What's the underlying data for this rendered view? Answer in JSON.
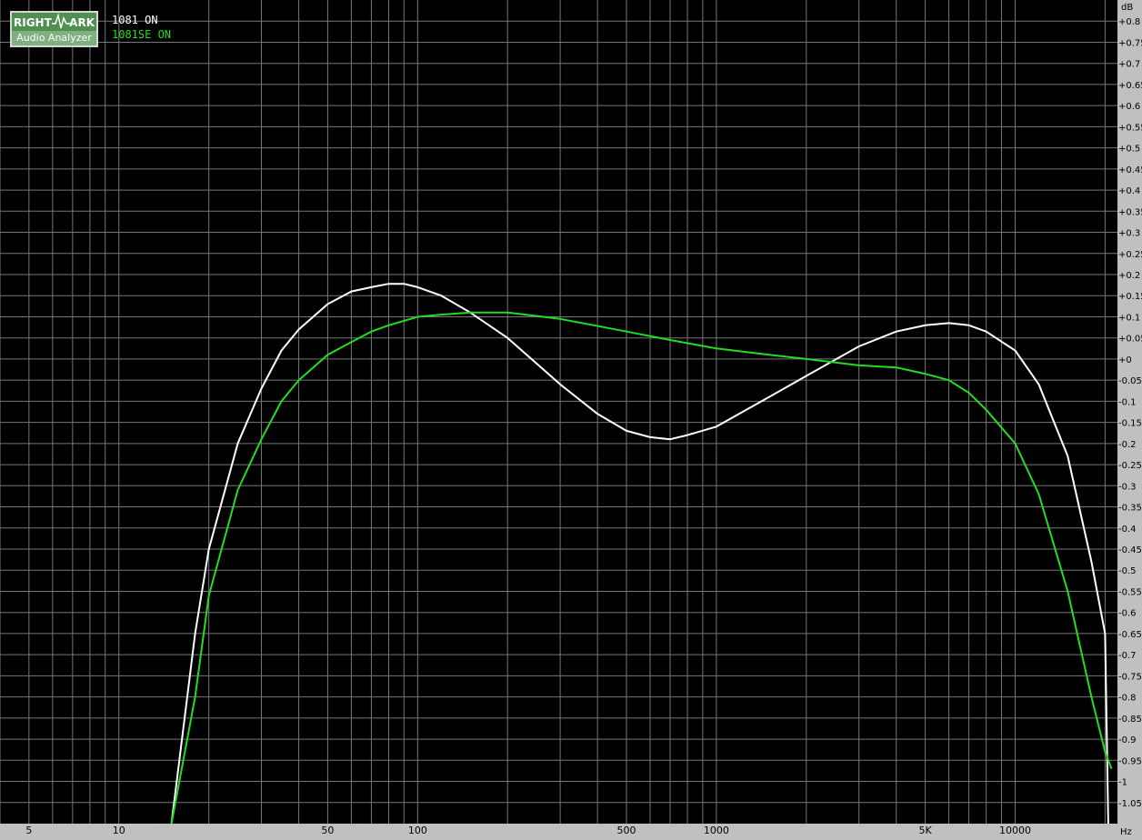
{
  "logo": {
    "word1": "RIGHT",
    "word2": "ARK",
    "subtitle": "Audio Analyzer"
  },
  "legend": [
    {
      "name": "1081 ON",
      "color": "#ffffff"
    },
    {
      "name": "1081SE ON",
      "color": "#22dd22"
    }
  ],
  "chart_data": {
    "type": "line",
    "xscale": "log",
    "xlim": [
      4,
      22000
    ],
    "ylim": [
      -1.1,
      0.85
    ],
    "grid": true,
    "xunit": "Hz",
    "yunit": "dB",
    "xticks": [
      {
        "v": 5,
        "label": "5"
      },
      {
        "v": 10,
        "label": "10"
      },
      {
        "v": 50,
        "label": "50"
      },
      {
        "v": 100,
        "label": "100"
      },
      {
        "v": 500,
        "label": "500"
      },
      {
        "v": 1000,
        "label": "1000"
      },
      {
        "v": 5000,
        "label": "5K"
      },
      {
        "v": 10000,
        "label": "10000"
      }
    ],
    "yticks": [
      "+0.8",
      "+0.75",
      "+0.7",
      "+0.65",
      "+0.6",
      "+0.55",
      "+0.5",
      "+0.45",
      "+0.4",
      "+0.35",
      "+0.3",
      "+0.25",
      "+0.2",
      "+0.15",
      "+0.1",
      "+0.05",
      "+0",
      "-0.05",
      "-0.1",
      "-0.15",
      "-0.2",
      "-0.25",
      "-0.3",
      "-0.35",
      "-0.4",
      "-0.45",
      "-0.5",
      "-0.55",
      "-0.6",
      "-0.65",
      "-0.7",
      "-0.75",
      "-0.8",
      "-0.85",
      "-0.9",
      "-0.95",
      "-1",
      "-1.05"
    ],
    "series": [
      {
        "name": "1081 ON",
        "color": "#ffffff",
        "x": [
          15,
          18,
          20,
          25,
          30,
          35,
          40,
          50,
          60,
          70,
          80,
          90,
          100,
          120,
          150,
          200,
          300,
          400,
          500,
          600,
          700,
          800,
          1000,
          1500,
          2000,
          3000,
          4000,
          5000,
          6000,
          7000,
          8000,
          10000,
          12000,
          15000,
          18000,
          20000,
          20500
        ],
        "y": [
          -1.1,
          -0.65,
          -0.45,
          -0.2,
          -0.07,
          0.02,
          0.07,
          0.13,
          0.16,
          0.17,
          0.178,
          0.178,
          0.17,
          0.15,
          0.11,
          0.05,
          -0.06,
          -0.13,
          -0.17,
          -0.185,
          -0.19,
          -0.18,
          -0.16,
          -0.09,
          -0.04,
          0.03,
          0.065,
          0.08,
          0.085,
          0.08,
          0.065,
          0.02,
          -0.06,
          -0.23,
          -0.48,
          -0.65,
          -1.1
        ]
      },
      {
        "name": "1081SE ON",
        "color": "#22dd22",
        "x": [
          15,
          18,
          20,
          25,
          30,
          35,
          40,
          50,
          60,
          70,
          80,
          100,
          120,
          150,
          200,
          300,
          500,
          700,
          1000,
          1500,
          2000,
          3000,
          4000,
          5000,
          6000,
          7000,
          8000,
          10000,
          12000,
          15000,
          18000,
          20000,
          21000
        ],
        "y": [
          -1.1,
          -0.8,
          -0.56,
          -0.31,
          -0.19,
          -0.1,
          -0.05,
          0.01,
          0.04,
          0.065,
          0.08,
          0.1,
          0.105,
          0.11,
          0.11,
          0.095,
          0.065,
          0.045,
          0.025,
          0.01,
          0.0,
          -0.015,
          -0.02,
          -0.035,
          -0.05,
          -0.08,
          -0.12,
          -0.2,
          -0.32,
          -0.55,
          -0.8,
          -0.93,
          -0.97
        ]
      }
    ]
  }
}
